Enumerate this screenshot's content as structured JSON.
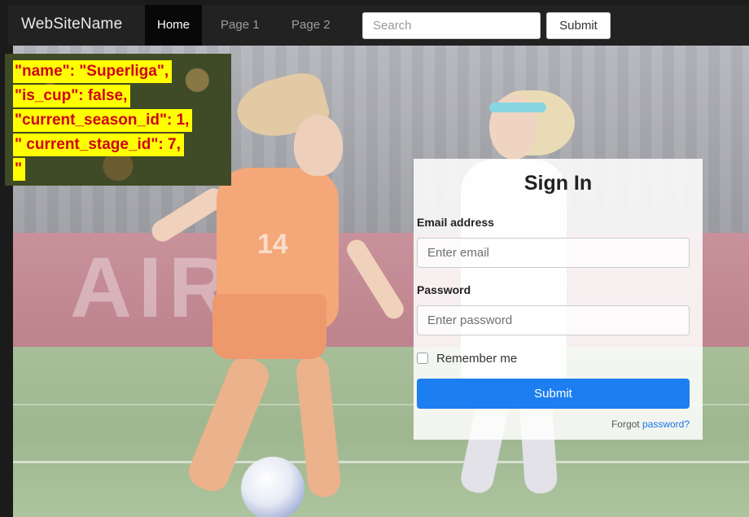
{
  "navbar": {
    "brand": "WebSiteName",
    "links": [
      "Home",
      "Page 1",
      "Page 2"
    ],
    "active_link": "Home",
    "search_placeholder": "Search",
    "submit_label": "Submit"
  },
  "background": {
    "banner_text": "AIR"
  },
  "annotation": {
    "lines": [
      "\"name\": \"Superliga\",",
      "\"is_cup\": false,",
      "\"current_season_id\": 1,",
      "\" current_stage_id\": 7,",
      "\""
    ],
    "colors": {
      "highlight": "#ffff00",
      "text": "#d0021b"
    }
  },
  "signin": {
    "title": "Sign In",
    "email_label": "Email address",
    "email_placeholder": "Enter email",
    "password_label": "Password",
    "password_placeholder": "Enter password",
    "remember_label": "Remember me",
    "remember_checked": false,
    "submit_label": "Submit",
    "forgot_prefix": "Forgot ",
    "forgot_link": "password?",
    "colors": {
      "primary": "#1c7ef0",
      "link": "#1a73e8"
    }
  }
}
